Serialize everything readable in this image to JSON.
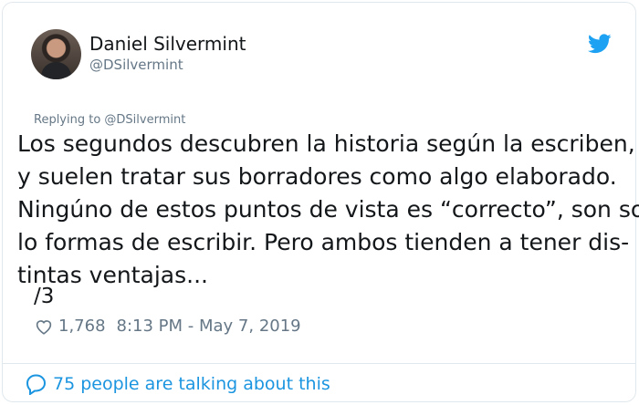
{
  "author": {
    "name": "Daniel Silvermint",
    "handle": "@DSilvermint"
  },
  "reply": {
    "label": "Replying to @DSilvermint"
  },
  "tweet": {
    "lines": [
      "Los segundos descubren la historia según la escriben,",
      "y suelen tratar sus borradores como algo elaborado.",
      "Ningúno de estos puntos de vista es “correcto”, son so-",
      "lo formas de escribir. Pero ambos tienden a tener dis-",
      "tintas ventajas..."
    ],
    "suffix": "/3"
  },
  "stats": {
    "likes": "1,768",
    "timestamp": "8:13 PM - May 7, 2019"
  },
  "footer": {
    "talking": "75 people are talking about this"
  },
  "icons": {
    "bird": "twitter-bird-icon",
    "heart": "heart-icon",
    "bubble": "speech-bubble-icon"
  },
  "colors": {
    "accent": "#1da1f2",
    "link": "#1b95e0",
    "muted": "#657786"
  }
}
